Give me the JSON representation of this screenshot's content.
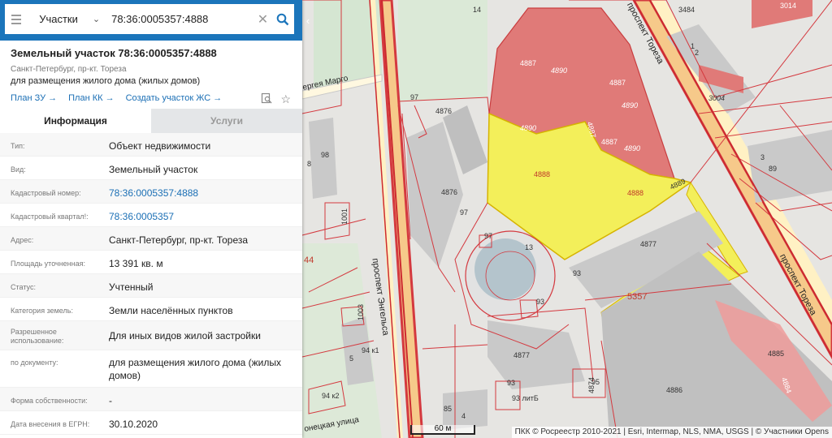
{
  "search": {
    "layer": "Участки",
    "query": "78:36:0005357:4888"
  },
  "object": {
    "title": "Земельный участок 78:36:0005357:4888",
    "address_short": "Санкт-Петербург, пр-кт. Тореза",
    "purpose": "для размещения жилого дома (жилых домов)",
    "links": [
      "План ЗУ →",
      "План КК →",
      "Создать участок ЖС →"
    ]
  },
  "tabs": [
    "Информация",
    "Услуги"
  ],
  "rows": [
    {
      "label": "Тип:",
      "value": "Объект недвижимости"
    },
    {
      "label": "Вид:",
      "value": "Земельный участок"
    },
    {
      "label": "Кадастровый номер:",
      "value": "78:36:0005357:4888"
    },
    {
      "label": "Кадастровый квартал!:",
      "value": "78:36:0005357"
    },
    {
      "label": "Адрес:",
      "value": "Санкт-Петербург, пр-кт. Тореза"
    },
    {
      "label": "Площадь уточненная:",
      "value": "13 391 кв. м"
    },
    {
      "label": "Статус:",
      "value": "Учтенный"
    },
    {
      "label": "Категория земель:",
      "value": "Земли населённых пунктов"
    },
    {
      "label": "Разрешенное использование:",
      "value": "Для иных видов жилой застройки"
    },
    {
      "label": "по документу:",
      "value": "для размещения жилого дома (жилых домов)"
    },
    {
      "label": "Форма собственности:",
      "value": "-"
    },
    {
      "label": "Дата внесения в ЕГРН:",
      "value": "30.10.2020"
    }
  ],
  "map": {
    "streets": {
      "engelsa": "проспект Энгельса",
      "toreza_top": "проспект Тореза",
      "toreza_right": "проспект Тореза",
      "margo": "ергея Марго",
      "bottom": "онецкая улица"
    },
    "parcels": {
      "p4887a": "4887",
      "p4890a": "4890",
      "p4887b": "4887",
      "p4890b": "4890",
      "p4887c": "4887",
      "p4890c": "4890",
      "p4890d": "4890",
      "p4887d": "4887",
      "p4888a": "4888",
      "p4888b": "4888",
      "p4889": "4889",
      "p4876a": "4876",
      "p4876b": "4876",
      "p4877a": "4877",
      "p4877b": "4877",
      "p5357": "5357",
      "p4885": "4885",
      "p4886": "4886",
      "p4884": "4884",
      "p3004": "3004",
      "p3484": "3484",
      "p3014": "3014",
      "p1001": "1001",
      "p1003": "1003",
      "p4874": "4874",
      "p14": "14",
      "p13": "13",
      "p44": "44"
    },
    "houses": {
      "h97a": "97",
      "h97b": "97",
      "h97c": "97",
      "h98": "98",
      "h8": "8",
      "h93a": "93",
      "h93b": "93",
      "h93c": "93",
      "h93lit": "93 литБ",
      "h94k1": "94 к1",
      "h94k2": "94 к2",
      "h5": "5",
      "h4": "4",
      "h85": "85",
      "h3": "3",
      "h89": "89",
      "h95": "95",
      "h1": "1",
      "h2": "2"
    },
    "scale": "60 м",
    "attribution": "ПКК © Росреестр 2010-2021 | Esri, Intermap, NLS, NMA, USGS | © Участники Opens"
  },
  "colors": {
    "accent": "#1b75bb",
    "selected_parcel": "#f3ef5a",
    "neighbor_parcel": "#e07a78",
    "boundary": "#d4393f"
  }
}
